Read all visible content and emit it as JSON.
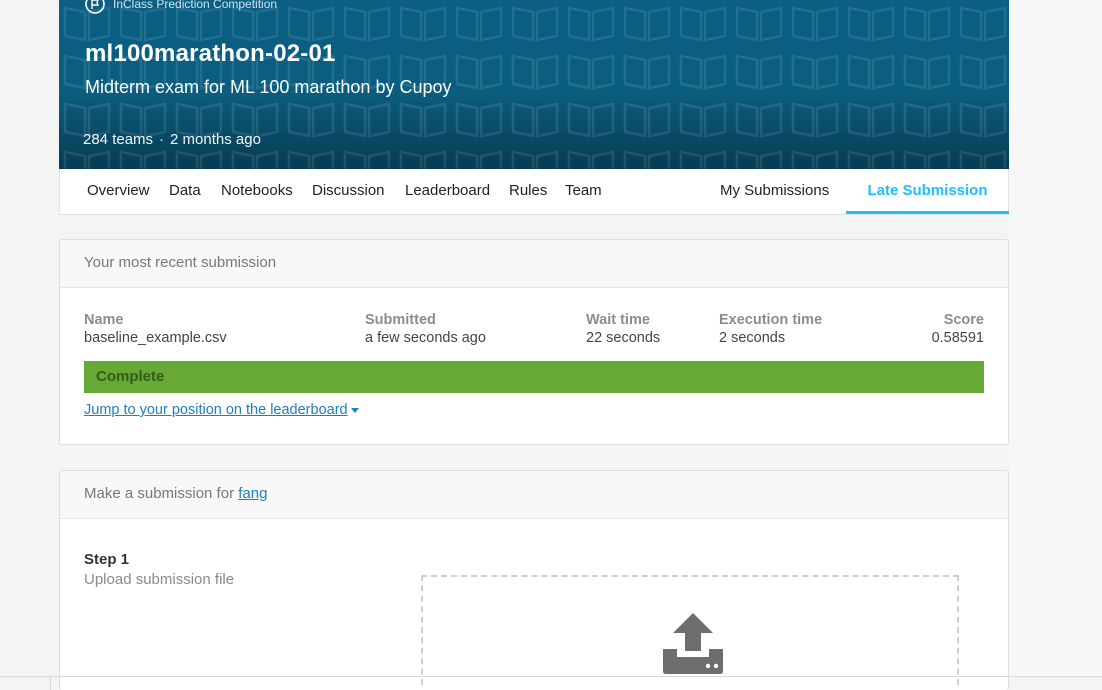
{
  "banner": {
    "kicker": "InClass Prediction Competition",
    "title": "ml100marathon-02-01",
    "subtitle": "Midterm exam for ML 100 marathon by Cupoy",
    "teams": "284 teams",
    "separator": "·",
    "age": "2 months ago"
  },
  "tabs": {
    "overview": "Overview",
    "data": "Data",
    "notebooks": "Notebooks",
    "discussion": "Discussion",
    "leaderboard": "Leaderboard",
    "rules": "Rules",
    "team": "Team",
    "my_submissions": "My Submissions",
    "late_submission": "Late Submission"
  },
  "recent": {
    "heading": "Your most recent submission",
    "columns": {
      "name_label": "Name",
      "name_value": "baseline_example.csv",
      "submitted_label": "Submitted",
      "submitted_value": "a few seconds ago",
      "wait_label": "Wait time",
      "wait_value": "22 seconds",
      "exec_label": "Execution time",
      "exec_value": "2 seconds",
      "score_label": "Score",
      "score_value": "0.58591"
    },
    "status": "Complete",
    "jump_link": "Jump to your position on the leaderboard"
  },
  "make_submission": {
    "heading_prefix": "Make a submission for ",
    "user": "fang",
    "step_title": "Step 1",
    "step_subtitle": "Upload submission file"
  },
  "colors": {
    "accent": "#20beff",
    "banner": "#0b5d7f",
    "complete": "#66a934",
    "link": "#1c7fbf"
  }
}
